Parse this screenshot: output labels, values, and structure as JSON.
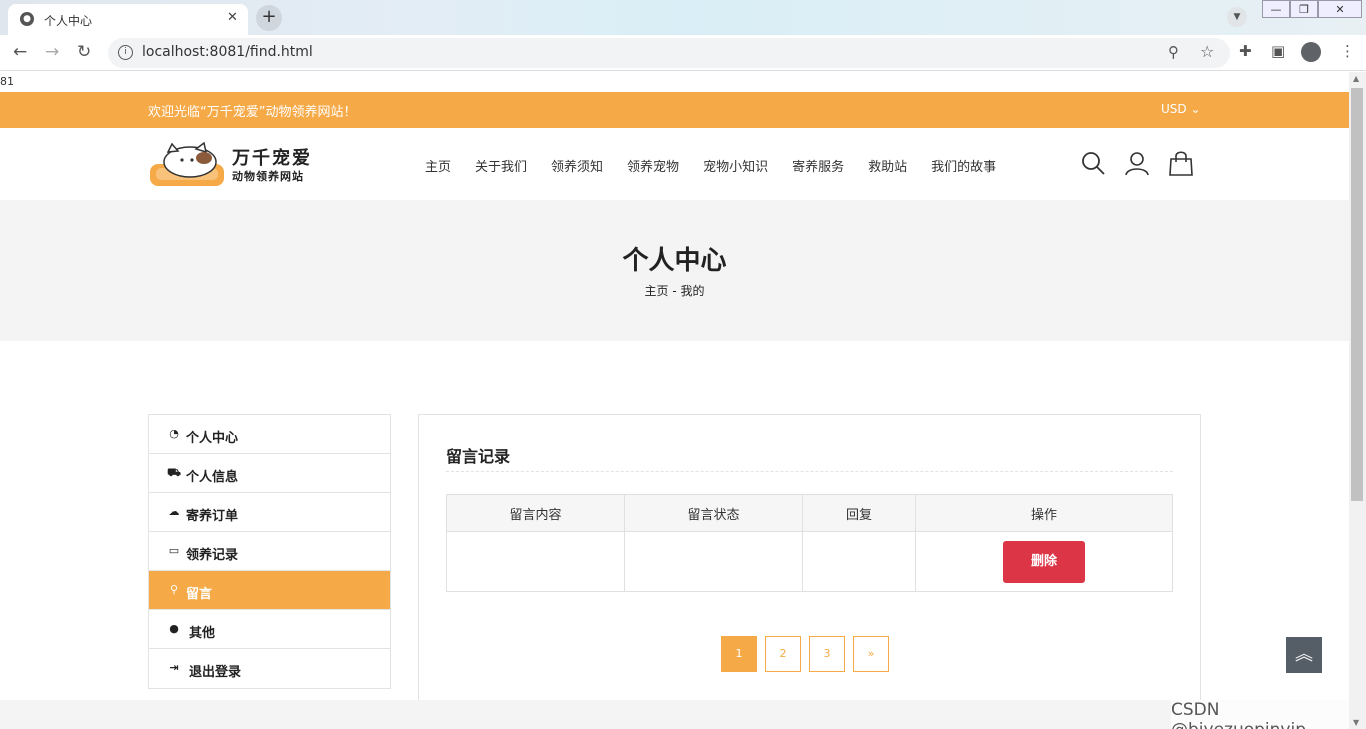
{
  "browser": {
    "tab_title": "个人中心",
    "url": "localhost:8081/find.html"
  },
  "page": {
    "debug_text": "81",
    "welcome": "欢迎光临“万千宠爱”动物领养网站！",
    "currency": "USD",
    "logo": {
      "title": "万千宠爱",
      "subtitle": "动物领养网站"
    },
    "nav": [
      "主页",
      "关于我们",
      "领养须知",
      "领养宠物",
      "宠物小知识",
      "寄养服务",
      "救助站",
      "我们的故事"
    ],
    "banner": {
      "title": "个人中心",
      "crumb_home": "主页",
      "crumb_sep": "-",
      "crumb_current": "我的"
    },
    "sidebar": [
      {
        "label": "个人中心",
        "icon": "dashboard-icon",
        "active": false
      },
      {
        "label": "个人信息",
        "icon": "cart-icon",
        "active": false
      },
      {
        "label": "寄养订单",
        "icon": "cloud-download-icon",
        "active": false
      },
      {
        "label": "领养记录",
        "icon": "credit-card-icon",
        "active": false
      },
      {
        "label": "留言",
        "icon": "map-marker-icon",
        "active": true
      },
      {
        "label": "其他",
        "icon": "user-icon",
        "active": false
      },
      {
        "label": "退出登录",
        "icon": "sign-out-icon",
        "active": false
      }
    ],
    "panel": {
      "title": "留言记录",
      "columns": [
        "留言内容",
        "留言状态",
        "回复",
        "操作"
      ],
      "rows": [
        {
          "content": "",
          "status": "",
          "reply": "",
          "action": "删除"
        }
      ]
    },
    "pagination": [
      "1",
      "2",
      "3",
      "»"
    ],
    "current_page": "1",
    "watermark": "CSDN @biyezuopinvip"
  },
  "colors": {
    "accent": "#f5a947",
    "danger": "#dc3545"
  }
}
